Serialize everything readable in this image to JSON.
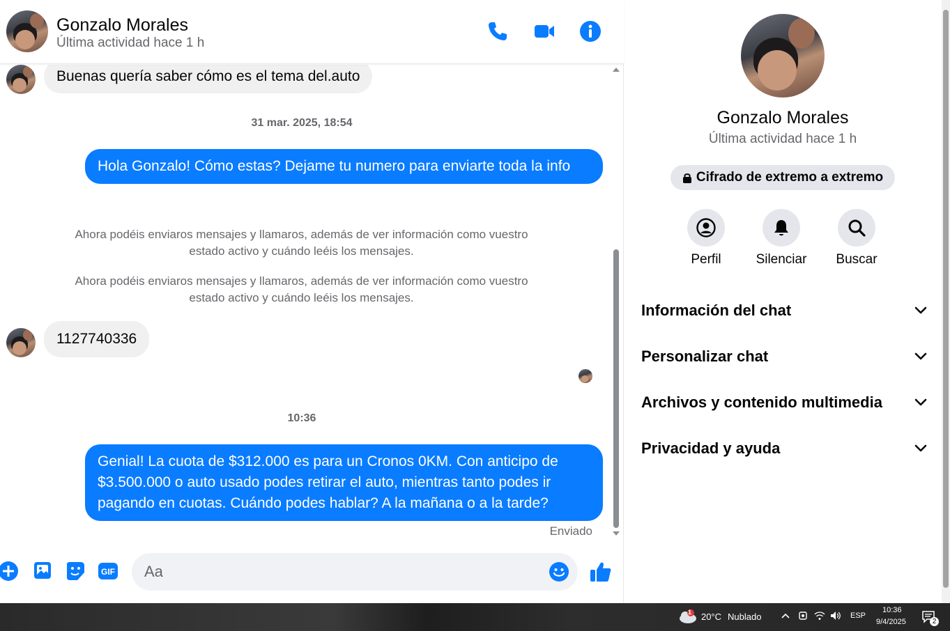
{
  "header": {
    "name": "Gonzalo Morales",
    "status": "Última actividad hace 1 h"
  },
  "messages": {
    "incoming_1": "Buenas quería saber cómo es el tema del.auto",
    "timestamp_1": "31 mar. 2025, 18:54",
    "outgoing_1": "Hola Gonzalo! Cómo estas? Dejame tu numero para enviarte toda la info",
    "notice_1": "Ahora podéis enviaros mensajes y llamaros, además de ver información como vuestro estado activo y cuándo leéis los mensajes.",
    "notice_2": "Ahora podéis enviaros mensajes y llamaros, además de ver información como vuestro estado activo y cuándo leéis los mensajes.",
    "incoming_2": "1127740336",
    "timestamp_2": "10:36",
    "outgoing_2": "Genial! La cuota de $312.000 es para un Cronos 0KM. Con anticipo de $3.500.000 o auto usado podes retirar el auto, mientras tanto podes ir pagando en cuotas. Cuándo podes hablar? A la mañana o a la tarde?",
    "sent_status": "Enviado"
  },
  "composer": {
    "placeholder": "Aa",
    "value": ""
  },
  "info": {
    "name": "Gonzalo Morales",
    "status": "Última actividad hace 1 h",
    "encryption": "Cifrado de extremo a extremo",
    "actions": [
      {
        "label": "Perfil",
        "icon": "profile-icon"
      },
      {
        "label": "Silenciar",
        "icon": "bell-icon"
      },
      {
        "label": "Buscar",
        "icon": "search-icon"
      }
    ],
    "sections": [
      "Información del chat",
      "Personalizar chat",
      "Archivos y contenido multimedia",
      "Privacidad y ayuda"
    ]
  },
  "taskbar": {
    "weather_temp": "20°C",
    "weather_desc": "Nublado",
    "weather_badge": "1",
    "language": "ESP",
    "time": "10:36",
    "date": "9/4/2025",
    "notifications": "2"
  },
  "colors": {
    "accent": "#0a7cff",
    "incoming_bubble": "#f0f0f0",
    "secondary_text": "#65676b"
  }
}
